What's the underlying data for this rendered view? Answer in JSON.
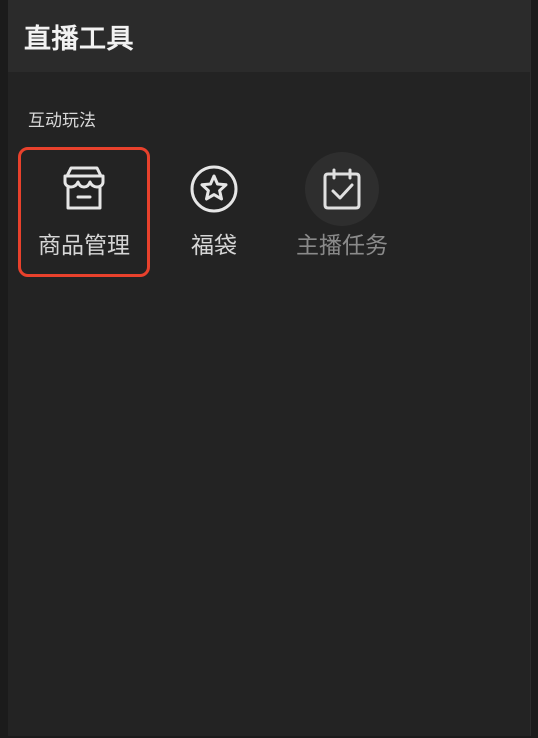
{
  "header": {
    "title": "直播工具"
  },
  "section": {
    "label": "互动玩法"
  },
  "tools": [
    {
      "label": "商品管理",
      "icon": "store-icon",
      "selected": true,
      "enabled": true
    },
    {
      "label": "福袋",
      "icon": "star-circle-icon",
      "selected": false,
      "enabled": true
    },
    {
      "label": "主播任务",
      "icon": "calendar-check-icon",
      "selected": false,
      "enabled": false
    }
  ],
  "colors": {
    "background": "#232323",
    "header": "#2b2b2b",
    "selection": "#e8412c",
    "text": "#d6d6d6",
    "disabled_text": "#8a8a8a"
  }
}
